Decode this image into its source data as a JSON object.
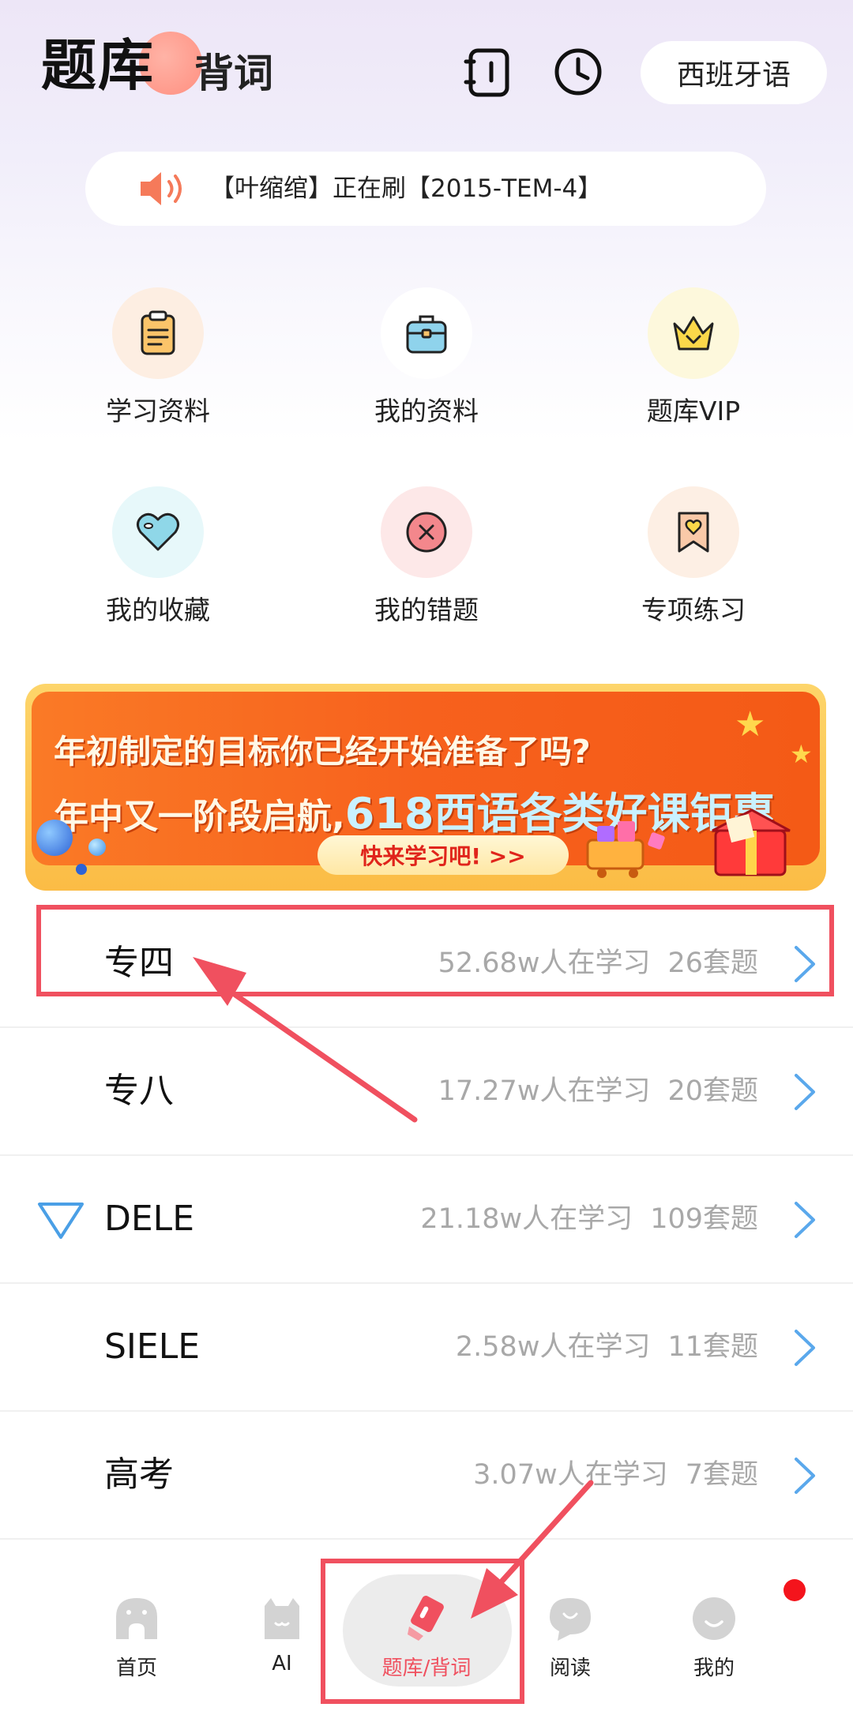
{
  "header": {
    "tab_active": "题库",
    "tab_inactive": "背词",
    "notebook_icon": "notebook-icon",
    "history_icon": "clock-icon",
    "language": "西班牙语"
  },
  "notice": {
    "icon": "speaker-icon",
    "text": "【叶缩绾】正在刷【2015-TEM-4】"
  },
  "grid": [
    {
      "label": "学习资料",
      "icon": "clipboard-icon",
      "color": "#fbe9da"
    },
    {
      "label": "我的资料",
      "icon": "briefcase-icon",
      "color": "#e8f6fb"
    },
    {
      "label": "题库VIP",
      "icon": "crown-icon",
      "color": "#fdf7d9"
    },
    {
      "label": "我的收藏",
      "icon": "heart-icon",
      "color": "#e6f7f9"
    },
    {
      "label": "我的错题",
      "icon": "x-circle-icon",
      "color": "#fde7e7"
    },
    {
      "label": "专项练习",
      "icon": "bookmark-heart-icon",
      "color": "#fdebe0"
    }
  ],
  "banner": {
    "line1": "年初制定的目标你已经开始准备了吗?",
    "line2_prefix": "年中又一阶段启航,",
    "line2_highlight": "618西语各类好课钜惠",
    "cta": "快来学习吧!  >>"
  },
  "exams": [
    {
      "title": "专四",
      "learners": "52.68w人在学习",
      "sets": "26套题"
    },
    {
      "title": "专八",
      "learners": "17.27w人在学习",
      "sets": "20套题"
    },
    {
      "title": "DELE",
      "learners": "21.18w人在学习",
      "sets": "109套题"
    },
    {
      "title": "SIELE",
      "learners": "2.58w人在学习",
      "sets": "11套题"
    },
    {
      "title": "高考",
      "learners": "3.07w人在学习",
      "sets": "7套题"
    }
  ],
  "bottom_nav": [
    {
      "label": "首页",
      "icon": "home-icon"
    },
    {
      "label": "AI",
      "icon": "ai-robot-icon"
    },
    {
      "label": "题库/背词",
      "icon": "eraser-icon",
      "active": true
    },
    {
      "label": "阅读",
      "icon": "chat-bubble-icon"
    },
    {
      "label": "我的",
      "icon": "profile-icon"
    }
  ],
  "colors": {
    "accent": "#f0505f",
    "chevron": "#5aa8ec",
    "meta_gray": "#a8a8a8"
  }
}
